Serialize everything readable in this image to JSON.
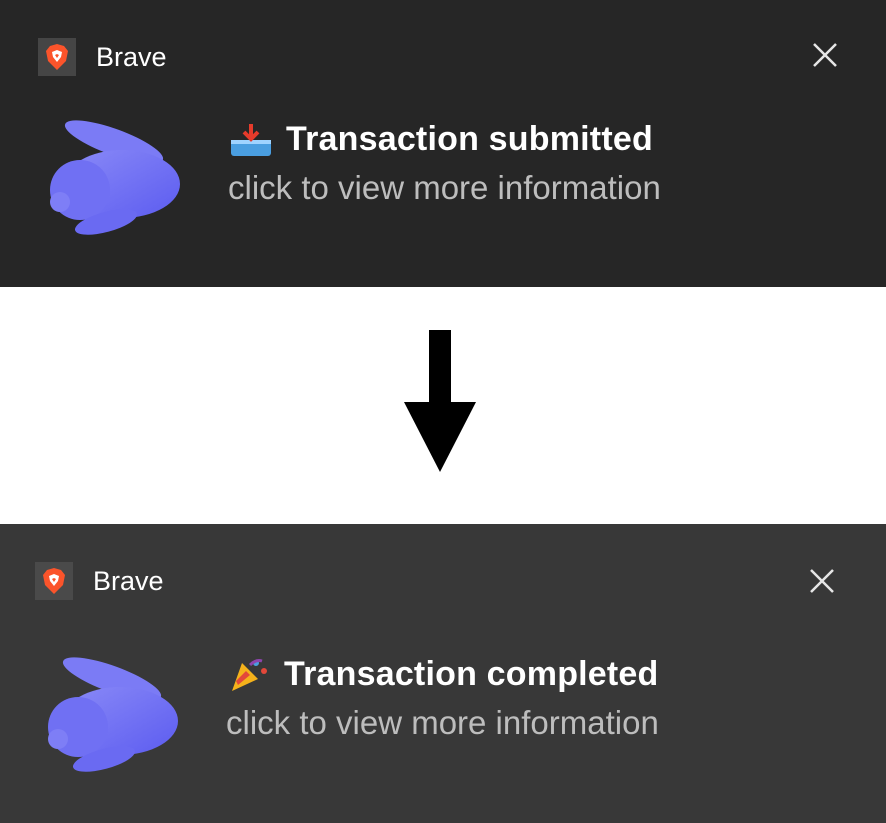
{
  "notifications": [
    {
      "app_name": "Brave",
      "title": "Transaction submitted",
      "message": "click to view more information",
      "title_icon": "inbox-tray-icon",
      "app_icon": "brave-lion-icon",
      "hero_icon": "rabbit-icon",
      "background": "#262626"
    },
    {
      "app_name": "Brave",
      "title": "Transaction completed",
      "message": "click to view more information",
      "title_icon": "party-popper-icon",
      "app_icon": "brave-lion-icon",
      "hero_icon": "rabbit-icon",
      "background": "#383838"
    }
  ],
  "transition_icon": "down-arrow-icon",
  "colors": {
    "brave_orange": "#fb542b",
    "rabbit_purple": "#6c6cf3",
    "subtitle_gray": "#bdbdbd"
  }
}
